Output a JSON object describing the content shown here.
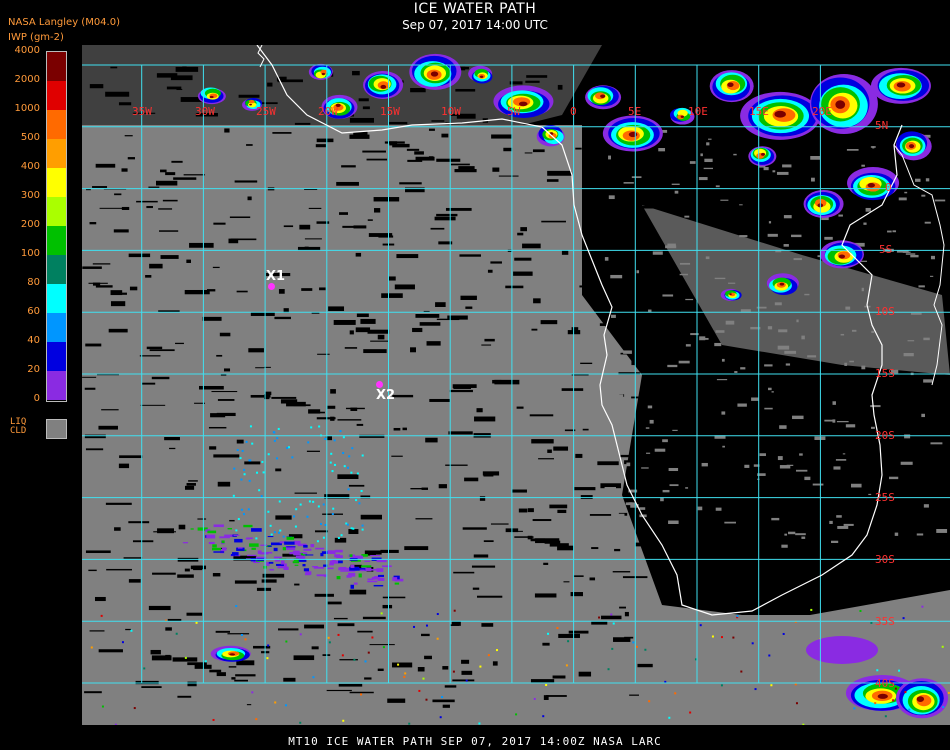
{
  "header": {
    "title": "ICE WATER PATH",
    "subtitle": "Sep 07, 2017 14:00 UTC",
    "org": "NASA Langley (M04.0)",
    "unit": "IWP (gm-2)"
  },
  "legend": {
    "ticks": [
      "4000",
      "2000",
      "1000",
      "500",
      "400",
      "300",
      "200",
      "100",
      "80",
      "60",
      "40",
      "20",
      "0"
    ],
    "colors": [
      "#7a0000",
      "#e00000",
      "#ff6a00",
      "#ff9e00",
      "#ffff00",
      "#aaff00",
      "#00c000",
      "#008060",
      "#00ffff",
      "#0096ff",
      "#0000e0",
      "#8a2be2"
    ],
    "liquid_label_1": "LIQ",
    "liquid_label_2": "CLD",
    "liquid_color": "#808080"
  },
  "map": {
    "grid_color": "#40e0f0",
    "coast_color": "#ffffff",
    "cloud_color": "#808080",
    "lon_labels": [
      "35W",
      "30W",
      "25W",
      "20W",
      "15W",
      "10W",
      "5W",
      "0",
      "5E",
      "10E",
      "15E",
      "20E"
    ],
    "lat_labels": [
      "5N",
      "0",
      "5S",
      "10S",
      "15S",
      "20S",
      "25S",
      "30S",
      "35S",
      "40S"
    ],
    "points": [
      {
        "label": "X1",
        "color": "#ff33ff"
      },
      {
        "label": "X2",
        "color": "#ff33ff"
      }
    ]
  },
  "footer": {
    "text": "MT10  ICE WATER PATH  SEP 07, 2017 14:00Z  NASA LARC"
  }
}
